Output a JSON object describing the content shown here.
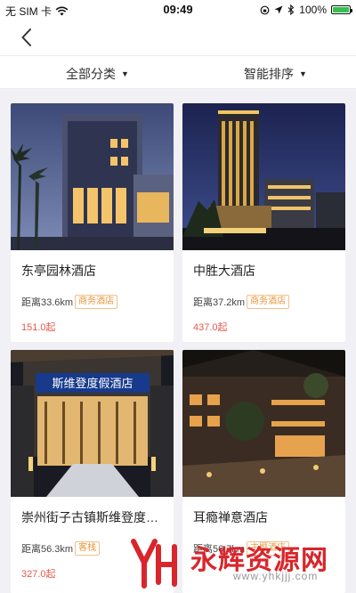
{
  "status_bar": {
    "carrier": "无 SIM 卡",
    "time": "09:49",
    "battery": "100%",
    "battery_level": 1.0
  },
  "nav": {
    "back_icon": "chevron-left-icon"
  },
  "filters": {
    "category": "全部分类",
    "sort": "智能排序"
  },
  "hotels": [
    {
      "name": "东亭园林酒店",
      "distance": "距离33.6km",
      "tag": "商务酒店",
      "price": "151.0起"
    },
    {
      "name": "中胜大酒店",
      "distance": "距离37.2km",
      "tag": "商务酒店",
      "price": "437.0起"
    },
    {
      "name": "崇州街子古镇斯维登度…",
      "distance": "距离56.3km",
      "tag": "客栈",
      "price": "327.0起",
      "photo_sign": "斯维登度假酒店"
    },
    {
      "name": "耳瘾禅意酒店",
      "distance": "距离56.7km",
      "tag": "主题酒店",
      "price": ""
    }
  ],
  "watermark": {
    "title": "永辉资源网",
    "url": "www.yhkjjj.com"
  },
  "colors": {
    "price": "#e8594c",
    "tag": "#e8963c",
    "watermark": "#d8262c",
    "battery": "#33c24d"
  }
}
